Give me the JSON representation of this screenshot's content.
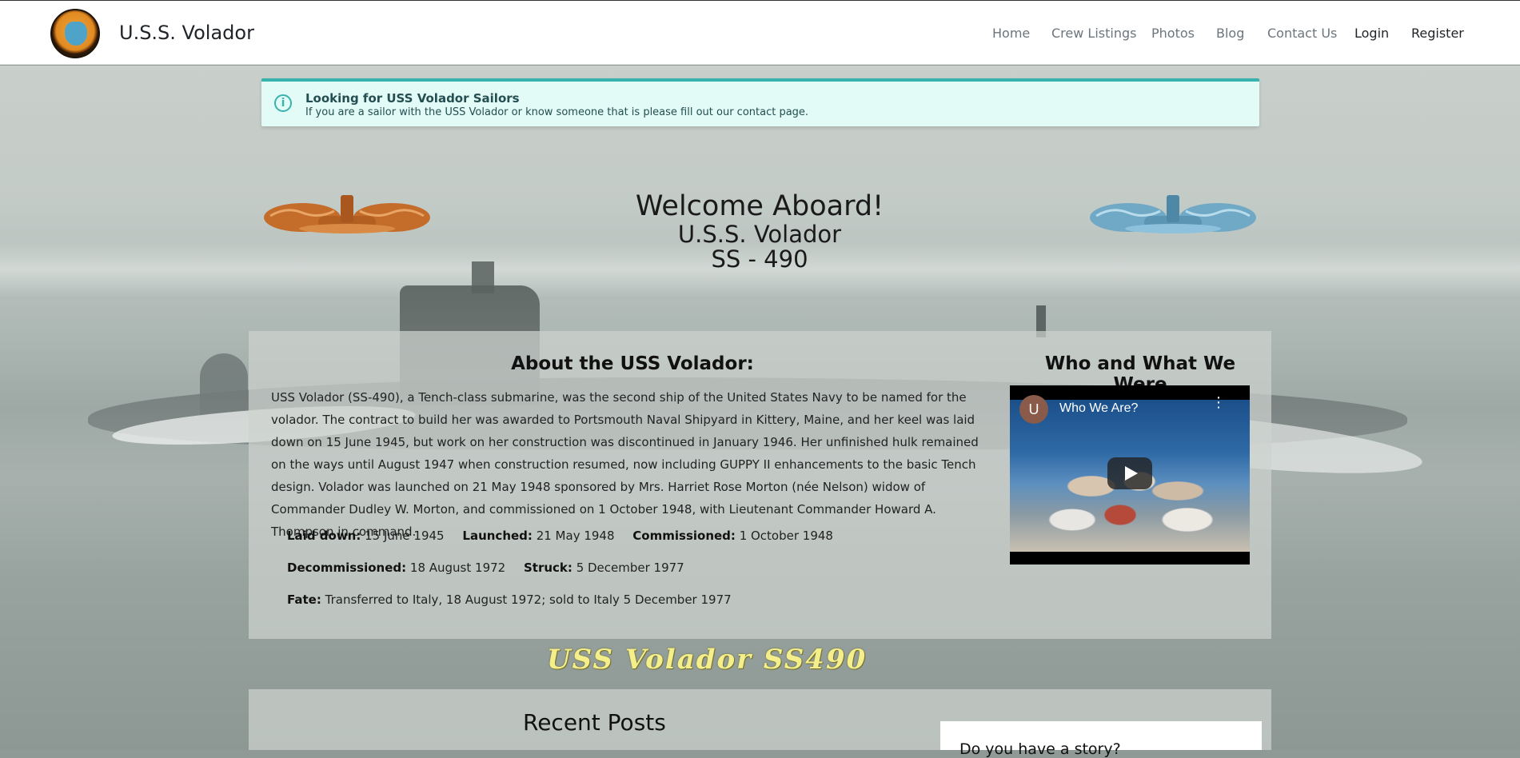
{
  "nav": {
    "brand": "U.S.S. Volador",
    "links": [
      "Home",
      "Crew Listings",
      "Photos",
      "Blog",
      "Contact Us",
      "Login",
      "Register"
    ]
  },
  "alert": {
    "title": "Looking for USS Volador Sailors",
    "text": "If you are a sailor with the USS Volador or know someone that is please fill out our contact page."
  },
  "welcome": {
    "line1": "Welcome Aboard!",
    "line2": "U.S.S. Volador",
    "line3": "SS - 490"
  },
  "about": {
    "title": "About the USS Volador:",
    "text": "USS Volador (SS-490), a Tench-class submarine, was the second ship of the United States Navy to be named for the volador. The contract to build her was awarded to Portsmouth Naval Shipyard in Kittery, Maine, and her keel was laid down on 15 June 1945, but work on her construction was discontinued in January 1946. Her unfinished hulk remained on the ways until August 1947 when construction resumed, now including GUPPY II enhancements to the basic Tench design. Volador was launched on 21 May 1948 sponsored by Mrs. Harriet Rose Morton (née Nelson) widow of Commander Dudley W. Morton, and commissioned on 1 October 1948, with Lieutenant Commander Howard A. Thompson in command.",
    "facts": {
      "laid_down_label": "Laid down:",
      "laid_down": "15 June 1945",
      "launched_label": "Launched:",
      "launched": "21 May 1948",
      "commissioned_label": "Commissioned:",
      "commissioned": "1 October 1948",
      "decommissioned_label": "Decommissioned:",
      "decommissioned": "18 August 1972",
      "struck_label": "Struck:",
      "struck": "5 December 1977",
      "fate_label": "Fate:",
      "fate": "Transferred to Italy, 18 August 1972; sold to Italy 5 December 1977"
    }
  },
  "video": {
    "section_title": "Who and What We Were",
    "avatar": "U",
    "title": "Who We Are?",
    "menu_icon": "more-vert-icon",
    "play_icon": "play-icon"
  },
  "banner": {
    "text": "USS Volador SS490"
  },
  "recent_posts": {
    "title": "Recent Posts"
  },
  "story": {
    "title": "Do you have a story?"
  },
  "colors": {
    "accent": "#38b2ac",
    "alert_bg": "#e3fbf6"
  }
}
